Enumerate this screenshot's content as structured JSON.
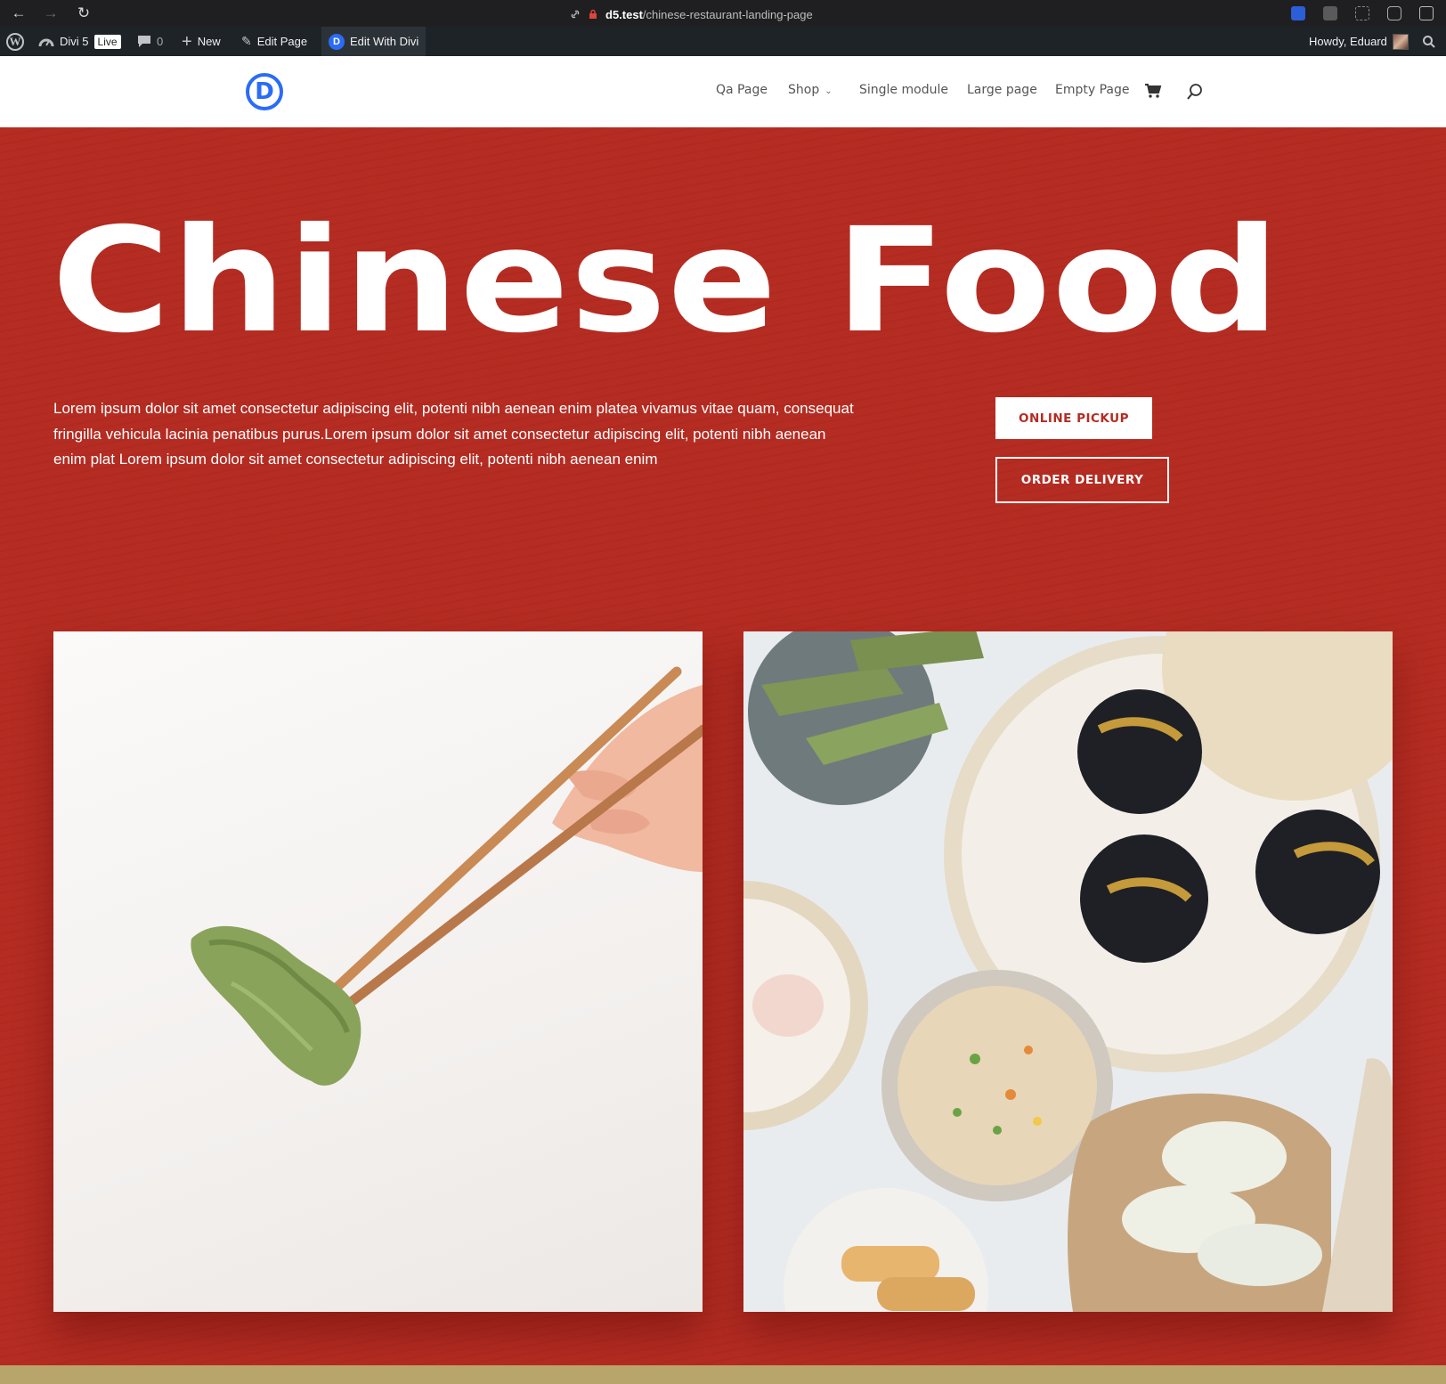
{
  "browser": {
    "url_domain": "d5.test",
    "url_path": "/chinese-restaurant-landing-page"
  },
  "admin_bar": {
    "site_name": "Divi 5",
    "live_badge": "Live",
    "comments_count": "0",
    "new_label": "New",
    "edit_page_label": "Edit Page",
    "edit_with_divi_label": "Edit With Divi",
    "greeting": "Howdy, Eduard"
  },
  "header": {
    "logo_letter": "D",
    "menu": [
      {
        "label": "Qa Page"
      },
      {
        "label": "Shop",
        "has_dropdown": true
      },
      {
        "label": "Single module"
      },
      {
        "label": "Large page"
      },
      {
        "label": "Empty Page"
      }
    ]
  },
  "hero": {
    "title": "Chinese Food",
    "body": "Lorem ipsum dolor sit amet consectetur adipiscing elit, potenti nibh aenean enim platea vivamus vitae quam, consequat fringilla vehicula lacinia penatibus purus.Lorem ipsum dolor sit amet consectetur adipiscing elit, potenti nibh aenean enim plat Lorem ipsum dolor sit amet consectetur adipiscing elit, potenti nibh aenean enim",
    "pickup_label": "ONLINE PICKUP",
    "delivery_label": "ORDER DELIVERY"
  },
  "colors": {
    "hero_red": "#b52c22",
    "divi_blue": "#2b6cf6",
    "admin_bar": "#1d2327",
    "band_gold": "#b8a56b"
  },
  "icons": [
    "back-arrow-icon",
    "forward-arrow-icon",
    "reload-icon",
    "link-icon",
    "lock-icon",
    "wordpress-icon",
    "dashboard-icon",
    "comment-icon",
    "plus-icon",
    "pencil-icon",
    "divi-icon",
    "cart-icon",
    "search-icon"
  ]
}
